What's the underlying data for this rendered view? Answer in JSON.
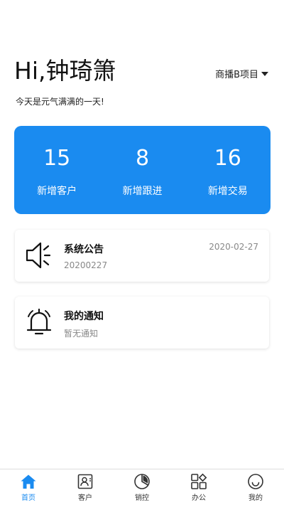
{
  "header": {
    "greeting": "Hi,钟琦箫",
    "project": "商播B项目",
    "subtitle": "今天是元气满满的一天!"
  },
  "stats": [
    {
      "value": "15",
      "label": "新增客户"
    },
    {
      "value": "8",
      "label": "新增跟进"
    },
    {
      "value": "16",
      "label": "新增交易"
    }
  ],
  "notice": {
    "title": "系统公告",
    "subtitle": "20200227",
    "date": "2020-02-27",
    "icon": "speaker-icon"
  },
  "notify": {
    "title": "我的通知",
    "subtitle": "暂无通知",
    "icon": "bell-icon"
  },
  "tabs": [
    {
      "label": "首页",
      "icon": "home-icon",
      "active": true
    },
    {
      "label": "客户",
      "icon": "contact-card-icon",
      "active": false
    },
    {
      "label": "销控",
      "icon": "pie-chart-icon",
      "active": false
    },
    {
      "label": "办公",
      "icon": "apps-grid-icon",
      "active": false
    },
    {
      "label": "我的",
      "icon": "smiley-icon",
      "active": false
    }
  ],
  "colors": {
    "accent": "#1a8bf0",
    "text": "#111111",
    "muted": "#888888"
  }
}
